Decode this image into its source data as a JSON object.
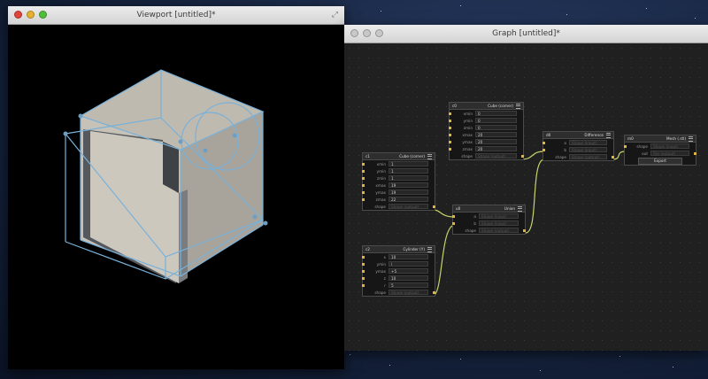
{
  "viewport": {
    "title": "Viewport [untitled]*"
  },
  "graph": {
    "title": "Graph [untitled]*",
    "nodes": {
      "c0": {
        "id": "c0",
        "title": "Cube (corner)",
        "rows": [
          {
            "label": "xmin",
            "value": "0"
          },
          {
            "label": "ymin",
            "value": "0"
          },
          {
            "label": "zmin",
            "value": "0"
          },
          {
            "label": "xmax",
            "value": "20"
          },
          {
            "label": "ymax",
            "value": "20"
          },
          {
            "label": "zmax",
            "value": "20"
          },
          {
            "label": "shape",
            "value": "Shape (output)",
            "placeholder": true
          }
        ]
      },
      "c1": {
        "id": "c1",
        "title": "Cube (corner)",
        "rows": [
          {
            "label": "xmin",
            "value": "1"
          },
          {
            "label": "ymin",
            "value": "1"
          },
          {
            "label": "zmin",
            "value": "1"
          },
          {
            "label": "xmax",
            "value": "19"
          },
          {
            "label": "ymax",
            "value": "19"
          },
          {
            "label": "zmax",
            "value": "22"
          },
          {
            "label": "shape",
            "value": "Shape (output)",
            "placeholder": true
          }
        ]
      },
      "c2": {
        "id": "c2",
        "title": "Cylinder (Y)",
        "rows": [
          {
            "label": "x",
            "value": "10"
          },
          {
            "label": "ymin",
            "value": "|"
          },
          {
            "label": "ymax",
            "value": "+5"
          },
          {
            "label": "z",
            "value": "10"
          },
          {
            "label": "r",
            "value": "5"
          },
          {
            "label": "shape",
            "value": "Shape (output)",
            "placeholder": true
          }
        ]
      },
      "u0": {
        "id": "u0",
        "title": "Union",
        "rows": [
          {
            "label": "a",
            "value": "Shape (input)",
            "placeholder": true
          },
          {
            "label": "b",
            "value": "Shape (input)",
            "placeholder": true
          },
          {
            "label": "shape",
            "value": "Shape (output)",
            "placeholder": true
          }
        ]
      },
      "d0": {
        "id": "d0",
        "title": "Difference",
        "rows": [
          {
            "label": "a",
            "value": "Shape (input)",
            "placeholder": true
          },
          {
            "label": "b",
            "value": "Shape (input)",
            "placeholder": true
          },
          {
            "label": "shape",
            "value": "Shape (output)",
            "placeholder": true
          }
        ]
      },
      "m0": {
        "id": "m0",
        "title": "Mesh (.stl)",
        "rows": [
          {
            "label": "shape",
            "value": "Shape (input)",
            "placeholder": true
          },
          {
            "label": "out",
            "value": "File (output)",
            "placeholder": true
          }
        ],
        "button": "Export"
      }
    }
  },
  "colors": {
    "port": "#e1b43e",
    "wire": "#c9d36a",
    "wireframe": "#79b1d9",
    "cube": "#c4bfb5"
  }
}
